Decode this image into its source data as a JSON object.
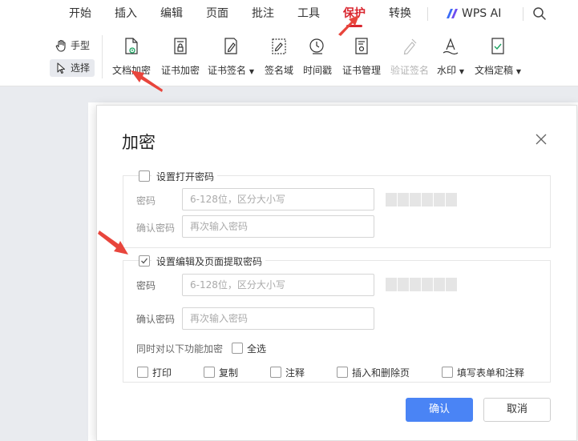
{
  "menu": {
    "items": [
      "开始",
      "插入",
      "编辑",
      "页面",
      "批注",
      "工具",
      "保护",
      "转换"
    ],
    "active": "保护",
    "wps_ai": "WPS AI"
  },
  "ribbon": {
    "hand_mode": "手型",
    "select_mode": "选择",
    "tools": [
      {
        "label": "文档加密"
      },
      {
        "label": "证书加密"
      },
      {
        "label": "证书签名"
      },
      {
        "label": "签名域"
      },
      {
        "label": "时间戳"
      },
      {
        "label": "证书管理"
      },
      {
        "label": "验证签名"
      },
      {
        "label": "水印"
      },
      {
        "label": "文档定稿"
      }
    ]
  },
  "dialog": {
    "title": "加密",
    "open_password": {
      "checkbox_label": "设置打开密码",
      "checked": false,
      "password_label": "密码",
      "password_placeholder": "6-128位，区分大小写",
      "confirm_label": "确认密码",
      "confirm_placeholder": "再次输入密码"
    },
    "edit_password": {
      "checkbox_label": "设置编辑及页面提取密码",
      "checked": true,
      "password_label": "密码",
      "password_placeholder": "6-128位，区分大小写",
      "confirm_label": "确认密码",
      "confirm_placeholder": "再次输入密码",
      "also_encrypt_label": "同时对以下功能加密",
      "select_all_label": "全选",
      "options": [
        "打印",
        "复制",
        "注释",
        "插入和删除页",
        "填写表单和注释"
      ]
    },
    "confirm_button": "确认",
    "cancel_button": "取消"
  },
  "colors": {
    "accent": "#4a84f5",
    "active_tab": "#d9262f",
    "annotation_arrow": "#e8453c"
  }
}
